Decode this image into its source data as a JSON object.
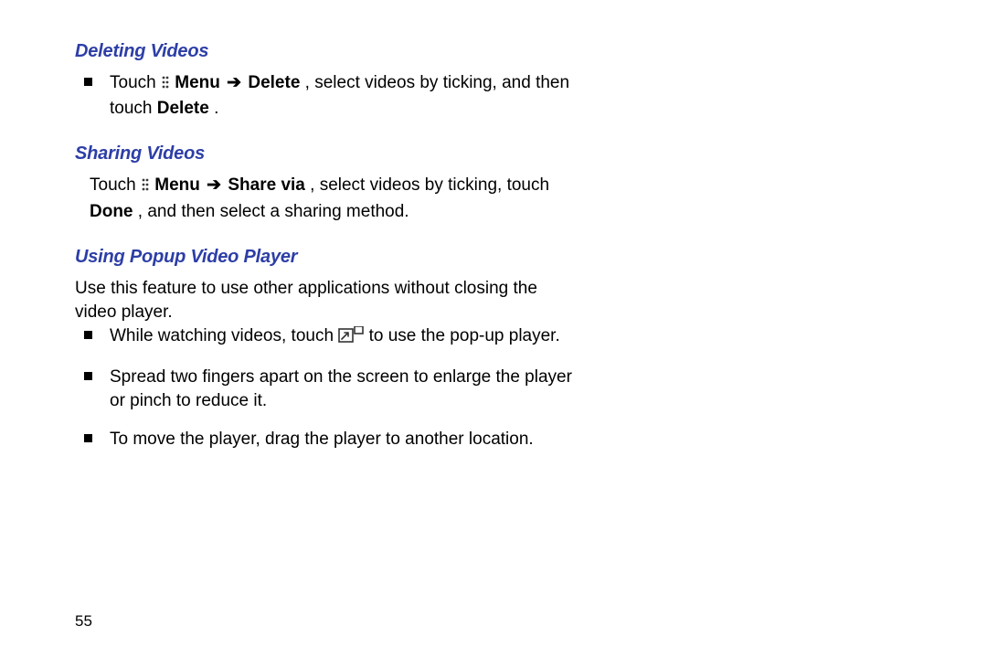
{
  "sections": {
    "deleting": {
      "heading": "Deleting Videos",
      "item": {
        "pre": "Touch ",
        "menu_word": "Menu",
        "arrow": "➔",
        "delete_word": "Delete",
        "mid": ", select videos by ticking, and then touch ",
        "delete_word2": "Delete",
        "post": "."
      }
    },
    "sharing": {
      "heading": "Sharing Videos",
      "para": {
        "pre": "Touch ",
        "menu_word": "Menu",
        "arrow": "➔",
        "sharevia_word": "Share via",
        "mid": ", select videos by ticking, touch ",
        "done_word": "Done",
        "post": ", and then select a sharing method."
      }
    },
    "popup": {
      "heading": "Using Popup Video Player",
      "intro": "Use this feature to use other applications without closing the video player.",
      "b1_pre": "While watching videos, touch ",
      "b1_post": " to use the pop-up player.",
      "b2": "Spread two fingers apart on the screen to enlarge the player or pinch to reduce it.",
      "b3": "To move the player, drag the player to another location."
    }
  },
  "page_number": "55",
  "icons": {
    "menu": "menu-icon",
    "popup": "popup-icon"
  }
}
